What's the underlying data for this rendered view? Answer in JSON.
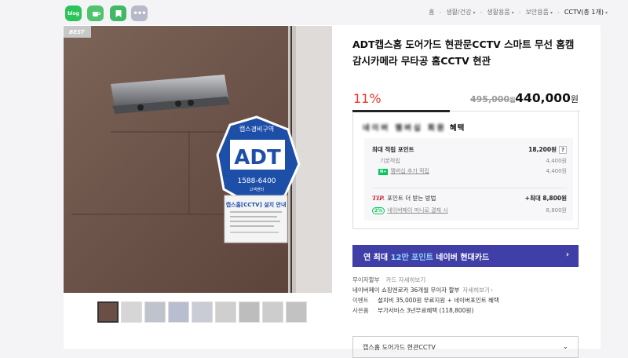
{
  "share_buttons": [
    {
      "label": "blog",
      "icon": "blog-icon"
    },
    {
      "label": "",
      "icon": "cafe-icon"
    },
    {
      "label": "",
      "icon": "post-icon"
    },
    {
      "label": "•••",
      "icon": "more-icon"
    }
  ],
  "breadcrumb": [
    "홈",
    "생활/건강",
    "생활용품",
    "보안용품",
    "CCTV(총 1개)"
  ],
  "product": {
    "badge": "BEST",
    "title": "ADT캡스홈 도어가드 현관문CCTV 스마트 무선 홈캠 감시카메라 무타공 홈CCTV 현관",
    "discount": "11%",
    "old_price": "495,000",
    "old_price_unit": "원",
    "price": "440,000",
    "price_unit": "원",
    "sign": {
      "top_text": "캡스경비구역",
      "logo": "ADT",
      "phone": "1588-6400",
      "sub": "고객센터"
    },
    "notice_card": {
      "title": "캡스홈[CCTV] 설치 안내"
    }
  },
  "benefits": {
    "heading_blurred": "네이버 멤버십 회원",
    "heading_suffix": "혜택",
    "max_points_label": "최대 적립 포인트",
    "max_points_value": "18,200원",
    "basic_label": "기본적립",
    "basic_value": "4,400원",
    "membership_badge": "N+",
    "membership_label": "멤버십 추가 적립",
    "membership_value": "4,400원",
    "tip_label": "TIP.",
    "tip_text": "포인트 더 받는 방법",
    "tip_value": "+최대 8,800원",
    "pay_badge": "2%",
    "pay_label": "네이버페이 머니로 결제 시",
    "pay_value": "8,800원"
  },
  "card_promo": {
    "prefix": "연 최대 ",
    "highlight": "12만 포인트",
    "suffix": " 네이버 현대카드",
    "arrow": "›"
  },
  "info_rows": [
    {
      "label": "무이자할부",
      "text": "카드 자세히보기",
      "link": ""
    },
    {
      "label": "",
      "text": "네이버페이 쇼핑엔로카 36개월 무이자 할부",
      "link": "자세히보기"
    },
    {
      "label": "이벤트",
      "text": "설치비 35,000원 무료지원 + 네이버포인트 혜택",
      "link": ""
    },
    {
      "label": "사은품",
      "text": "부가서비스 3년무료혜택 (118,800원)",
      "link": ""
    }
  ],
  "option_select": {
    "value": "캡스홈 도어가드 현관CCTV",
    "chevron": "⌄"
  },
  "colors": {
    "discount": "#f1362b",
    "card_button": "#3f3fa7",
    "naver_green": "#03c75a",
    "tip_red": "#c81d25"
  }
}
